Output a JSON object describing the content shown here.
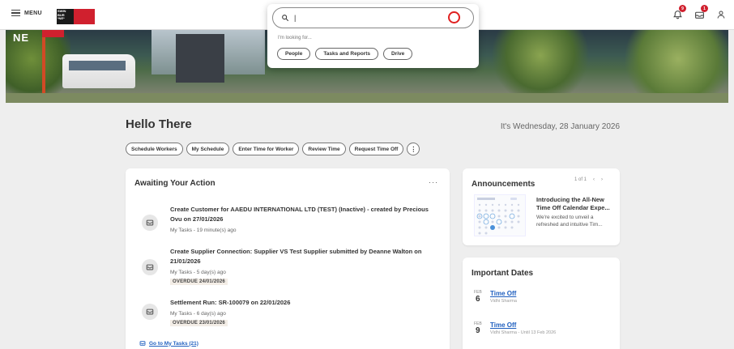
{
  "topbar": {
    "menu_label": "MENU",
    "logo_text_left": "SWIN BUR *NE*",
    "notifications_count": "9",
    "inbox_count": "1"
  },
  "search": {
    "placeholder": "",
    "looking_for": "I'm looking for...",
    "chips": [
      "People",
      "Tasks and Reports",
      "Drive"
    ]
  },
  "banner": {
    "overlay_text": "NE"
  },
  "greeting": {
    "title": "Hello There",
    "date": "It's Wednesday, 28 January 2026"
  },
  "quick_actions": [
    "Schedule Workers",
    "My Schedule",
    "Enter Time for Worker",
    "Review Time",
    "Request Time Off"
  ],
  "awaiting": {
    "title": "Awaiting Your Action",
    "more": "···",
    "tasks": [
      {
        "title": "Create Customer for AAEDU INTERNATIONAL LTD (TEST) (Inactive) - created by Precious Ovu on 27/01/2026",
        "meta": "My Tasks - 19 minute(s) ago",
        "overdue": ""
      },
      {
        "title": "Create Supplier Connection: Supplier VS Test Supplier submitted by Deanne Walton on 21/01/2026",
        "meta": "My Tasks - 5 day(s) ago",
        "overdue": "OVERDUE 24/01/2026"
      },
      {
        "title": "Settlement Run: SR-100079 on 22/01/2026",
        "meta": "My Tasks - 6 day(s) ago",
        "overdue": "OVERDUE 23/01/2026"
      }
    ],
    "goto_label": "Go to My Tasks (21)"
  },
  "announcements": {
    "title": "Announcements",
    "pager": "1 of 1",
    "headline": "Introducing the All-New Time Off Calendar Expe...",
    "body": "We're excited to unveil a refreshed and intuitive Tim..."
  },
  "important_dates": {
    "title": "Important Dates",
    "items": [
      {
        "month": "FEB",
        "day": "6",
        "link": "Time Off",
        "sub": "Vidhi Sharma"
      },
      {
        "month": "FEB",
        "day": "9",
        "link": "Time Off",
        "sub": "Vidhi Sharma - Until 13 Feb 2026"
      }
    ]
  },
  "colors": {
    "accent_red": "#d0202e",
    "link_blue": "#1f5fbf",
    "background": "#eeeeee"
  }
}
